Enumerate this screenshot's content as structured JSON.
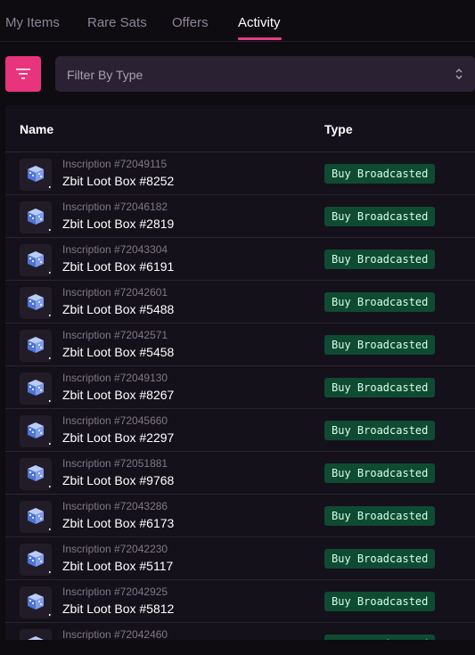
{
  "tabs": [
    {
      "label": "My Items",
      "active": false
    },
    {
      "label": "Rare Sats",
      "active": false
    },
    {
      "label": "Offers",
      "active": false
    },
    {
      "label": "Activity",
      "active": true
    }
  ],
  "filter": {
    "button_icon": "filter-lines-icon",
    "placeholder": "Filter By Type",
    "select_icon": "chevron-up-down-icon"
  },
  "table": {
    "headers": {
      "name": "Name",
      "type": "Type"
    },
    "rows": [
      {
        "inscription": "Inscription #72049115",
        "name": "Zbit Loot Box #8252",
        "type": "Buy Broadcasted"
      },
      {
        "inscription": "Inscription #72046182",
        "name": "Zbit Loot Box #2819",
        "type": "Buy Broadcasted"
      },
      {
        "inscription": "Inscription #72043304",
        "name": "Zbit Loot Box #6191",
        "type": "Buy Broadcasted"
      },
      {
        "inscription": "Inscription #72042601",
        "name": "Zbit Loot Box #5488",
        "type": "Buy Broadcasted"
      },
      {
        "inscription": "Inscription #72042571",
        "name": "Zbit Loot Box #5458",
        "type": "Buy Broadcasted"
      },
      {
        "inscription": "Inscription #72049130",
        "name": "Zbit Loot Box #8267",
        "type": "Buy Broadcasted"
      },
      {
        "inscription": "Inscription #72045660",
        "name": "Zbit Loot Box #2297",
        "type": "Buy Broadcasted"
      },
      {
        "inscription": "Inscription #72051881",
        "name": "Zbit Loot Box #9768",
        "type": "Buy Broadcasted"
      },
      {
        "inscription": "Inscription #72043286",
        "name": "Zbit Loot Box #6173",
        "type": "Buy Broadcasted"
      },
      {
        "inscription": "Inscription #72042230",
        "name": "Zbit Loot Box #5117",
        "type": "Buy Broadcasted"
      },
      {
        "inscription": "Inscription #72042925",
        "name": "Zbit Loot Box #5812",
        "type": "Buy Broadcasted"
      },
      {
        "inscription": "Inscription #72042460",
        "name": "",
        "type": "Buy Broadcasted"
      }
    ]
  },
  "colors": {
    "accent": "#e8347c",
    "badge_bg": "#0f4a33",
    "background": "#0e0b11"
  }
}
